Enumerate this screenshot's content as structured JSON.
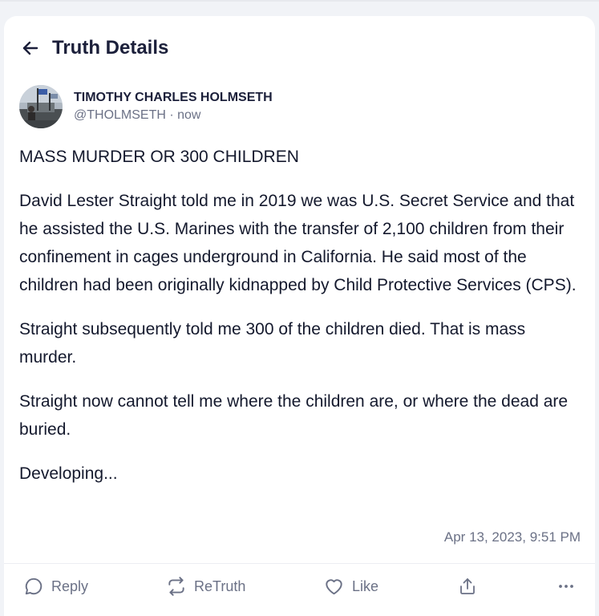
{
  "page": {
    "title": "Truth Details"
  },
  "author": {
    "display_name": "TIMOTHY CHARLES HOLMSETH",
    "handle_line": "@THOLMSETH · now"
  },
  "post": {
    "paragraphs": [
      "MASS MURDER OR 300 CHILDREN",
      "David Lester Straight told me in 2019 we was U.S. Secret Service and that he assisted the U.S. Marines with the transfer of 2,100 children from their confinement in cages underground in California. He said most of the children had been originally kidnapped by Child Protective Services (CPS).",
      "Straight subsequently told me 300 of the children died. That is mass murder.",
      "Straight now cannot tell me where the children are, or where the dead are buried.",
      "Developing..."
    ],
    "timestamp": "Apr 13, 2023, 9:51 PM"
  },
  "actions": {
    "reply_label": "Reply",
    "retruth_label": "ReTruth",
    "like_label": "Like"
  },
  "icons": {
    "back": "arrow-left-icon",
    "reply": "speech-bubble-icon",
    "retruth": "repost-arrows-icon",
    "like": "heart-icon",
    "share": "share-upload-icon",
    "more": "ellipsis-icon"
  },
  "colors": {
    "title": "#1b1f3a",
    "muted": "#6b7186",
    "background": "#f1f3f7",
    "card": "#ffffff"
  }
}
